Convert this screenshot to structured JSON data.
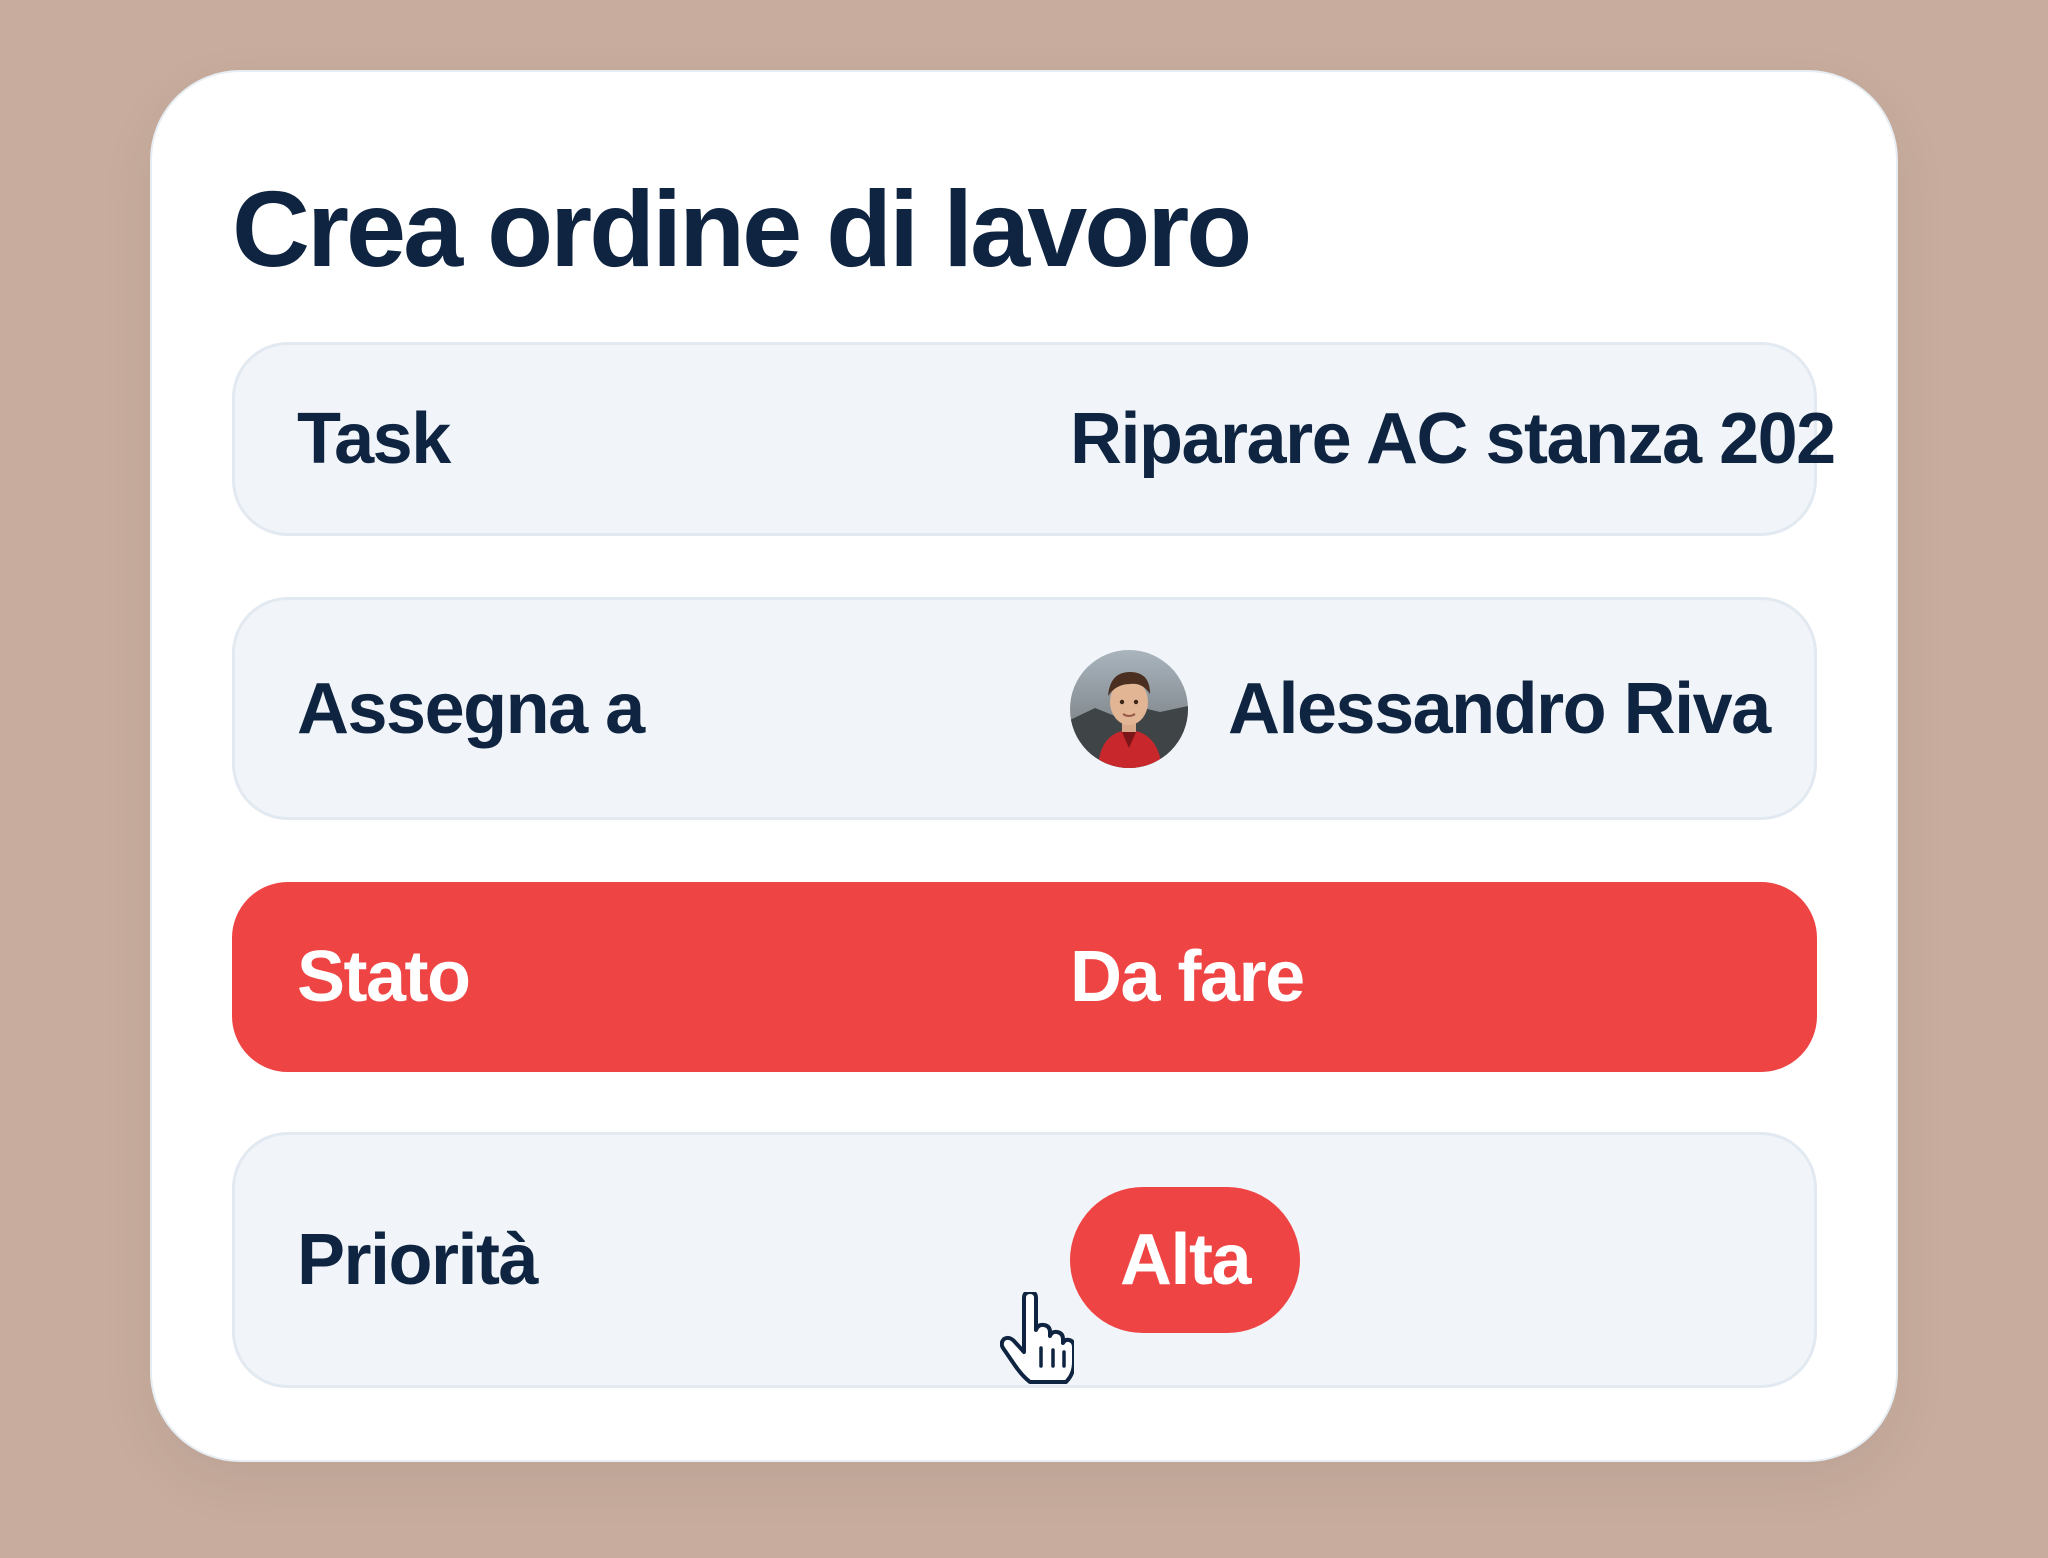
{
  "form": {
    "title": "Crea ordine di lavoro",
    "fields": {
      "task": {
        "label": "Task",
        "value": "Riparare AC stanza 202"
      },
      "assign": {
        "label": "Assegna a",
        "value": "Alessandro Riva",
        "avatar_icon": "user-avatar-photo"
      },
      "status": {
        "label": "Stato",
        "value": "Da fare",
        "color": "#ef4444"
      },
      "priority": {
        "label": "Priorità",
        "value": "Alta",
        "color": "#ef4444"
      }
    }
  },
  "colors": {
    "background": "#c8ad9e",
    "card": "#ffffff",
    "field": "#f1f5f9",
    "text": "#0f2440",
    "accent": "#ef4444"
  },
  "cursor": {
    "icon": "hand-pointer-icon"
  }
}
